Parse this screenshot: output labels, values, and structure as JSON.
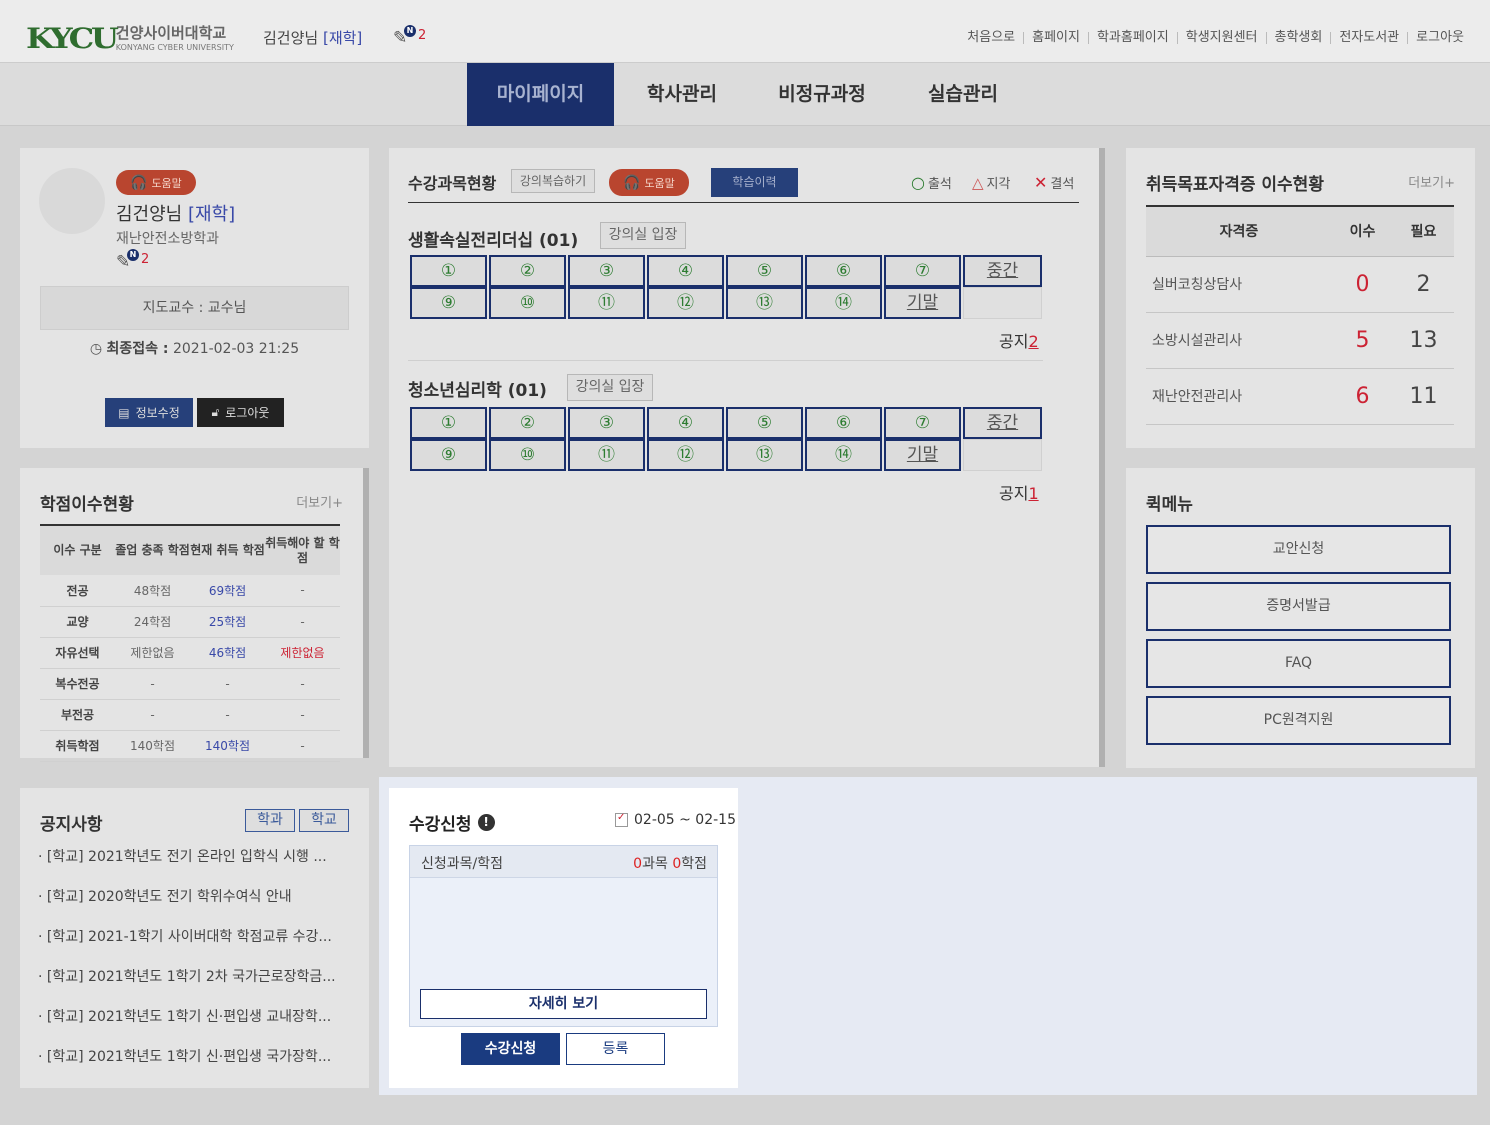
{
  "header": {
    "logo_mark": "KYCU",
    "logo_kr": "건양사이버대학교",
    "logo_en": "KONYANG CYBER UNIVERSITY",
    "user_name": "김건양님",
    "user_status": "[재학]",
    "notif_badge": "N",
    "notif_count": "2",
    "links": [
      "처음으로",
      "홈페이지",
      "학과홈페이지",
      "학생지원센터",
      "총학생회",
      "전자도서관",
      "로그아웃"
    ]
  },
  "gnb": {
    "items": [
      "마이페이지",
      "학사관리",
      "비정규과정",
      "실습관리"
    ],
    "active": "마이페이지"
  },
  "profile": {
    "help_label": "도움말",
    "name": "김건양님",
    "status": "[재학]",
    "dept": "재난안전소방학과",
    "notif_count": "2",
    "advisor": "지도교수 : 교수님",
    "last_login_label": "최종접속 :",
    "last_login": "2021-02-03 21:25",
    "edit_label": "정보수정",
    "logout_label": "로그아웃"
  },
  "course": {
    "title": "수강과목현황",
    "review_tag": "강의복습하기",
    "help_label": "도움말",
    "history_label": "학습이력",
    "legend": {
      "present": "출석",
      "late": "지각",
      "absent": "결석"
    },
    "subjects": [
      {
        "name": "생활속실전리더십 (01)",
        "enter": "강의실 입장",
        "row1": [
          "①",
          "②",
          "③",
          "④",
          "⑤",
          "⑥",
          "⑦",
          "중간"
        ],
        "row2": [
          "⑨",
          "⑩",
          "⑪",
          "⑫",
          "⑬",
          "⑭",
          "기말"
        ],
        "notice_label": "공지",
        "notice_count": "2"
      },
      {
        "name": "청소년심리학 (01)",
        "enter": "강의실 입장",
        "row1": [
          "①",
          "②",
          "③",
          "④",
          "⑤",
          "⑥",
          "⑦",
          "중간"
        ],
        "row2": [
          "⑨",
          "⑩",
          "⑪",
          "⑫",
          "⑬",
          "⑭",
          "기말"
        ],
        "notice_label": "공지",
        "notice_count": "1"
      }
    ]
  },
  "cert": {
    "title": "취득목표자격증 이수현황",
    "more": "더보기+",
    "headers": [
      "자격증",
      "이수",
      "필요"
    ],
    "rows": [
      {
        "name": "실버코칭상담사",
        "done": "0",
        "need": "2"
      },
      {
        "name": "소방시설관리사",
        "done": "5",
        "need": "13"
      },
      {
        "name": "재난안전관리사",
        "done": "6",
        "need": "11"
      }
    ]
  },
  "credit": {
    "title": "학점이수현황",
    "more": "더보기+",
    "headers": [
      "이수 구분",
      "졸업 충족 학점",
      "현재 취득 학점",
      "취득해야 할 학점"
    ],
    "rows": [
      [
        "전공",
        "48학점",
        "69학점",
        "-"
      ],
      [
        "교양",
        "24학점",
        "25학점",
        "-"
      ],
      [
        "자유선택",
        "제한없음",
        "46학점",
        "제한없음"
      ],
      [
        "복수전공",
        "-",
        "-",
        "-"
      ],
      [
        "부전공",
        "-",
        "-",
        "-"
      ],
      [
        "취득학점",
        "140학점",
        "140학점",
        "-"
      ]
    ]
  },
  "quick": {
    "title": "퀵메뉴",
    "items": [
      "교안신청",
      "증명서발급",
      "FAQ",
      "PC원격지원"
    ]
  },
  "notices": {
    "title": "공지사항",
    "tabs": [
      "학과",
      "학교"
    ],
    "items": [
      "[학교] 2021학년도 전기 온라인 입학식 시행 ...",
      "[학교] 2020학년도 전기 학위수여식 안내",
      "[학교] 2021-1학기 사이버대학 학점교류 수강...",
      "[학교] 2021학년도 1학기 2차 국가근로장학금...",
      "[학교] 2021학년도 1학기 신·편입생 교내장학...",
      "[학교] 2021학년도 1학기 신·편입생 국가장학..."
    ]
  },
  "registration": {
    "title": "수강신청",
    "info_icon": "!",
    "date": "02-05 ~ 02-15",
    "summary_label": "신청과목/학점",
    "courses": "0",
    "courses_unit": "과목",
    "credits": "0",
    "credits_unit": "학점",
    "detail_label": "자세히 보기",
    "apply_label": "수강신청",
    "register_label": "등록"
  }
}
